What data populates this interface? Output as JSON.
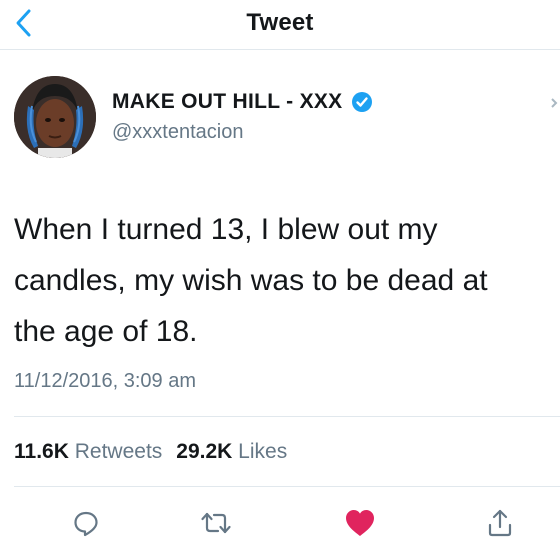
{
  "header": {
    "title": "Tweet"
  },
  "author": {
    "display_name": "MAKE OUT HILL - XXX",
    "username": "@xxxtentacion",
    "verified": true
  },
  "tweet": {
    "lines": [
      "When I turned 13, I blew out my",
      "candles, my wish was to be dead at",
      "the age of 18."
    ],
    "timestamp": "11/12/2016, 3:09 am"
  },
  "stats": {
    "retweets_count": "11.6K",
    "retweets_label": "Retweets",
    "likes_count": "29.2K",
    "likes_label": "Likes"
  },
  "actions": [
    "reply-icon",
    "retweet-icon",
    "like-icon",
    "share-icon"
  ],
  "colors": {
    "accent": "#1da1f2",
    "like": "#e0245e",
    "secondary_text": "#657786"
  }
}
